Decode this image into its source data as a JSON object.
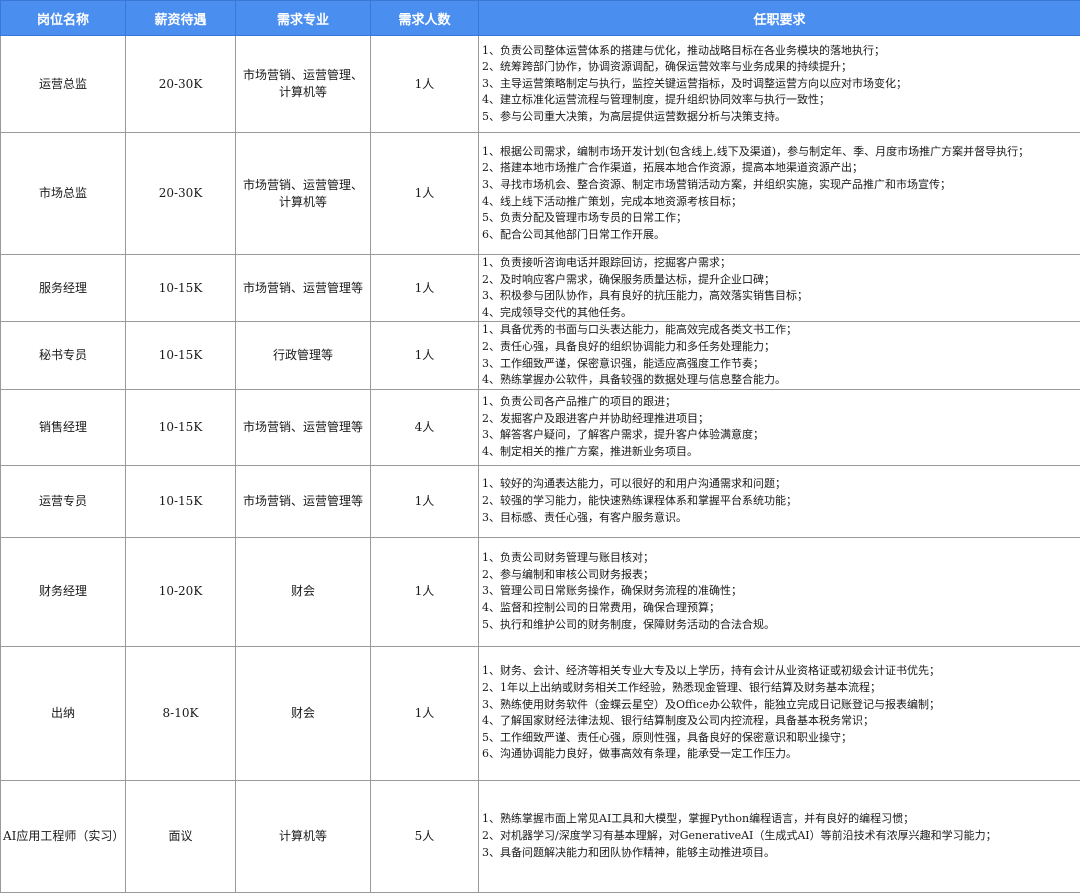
{
  "headers": [
    "岗位名称",
    "薪资待遇",
    "需求专业",
    "需求人数",
    "任职要求"
  ],
  "rows": [
    {
      "title": "运营总监",
      "salary": "20-30K",
      "major": "市场营销、运营管理、计算机等",
      "count": "1人",
      "requirements": [
        "1、负责公司整体运营体系的搭建与优化，推动战略目标在各业务模块的落地执行；",
        "2、统筹跨部门协作，协调资源调配，确保运营效率与业务成果的持续提升；",
        "3、主导运营策略制定与执行，监控关键运营指标，及时调整运营方向以应对市场变化；",
        "4、建立标准化运营流程与管理制度，提升组织协同效率与执行一致性；",
        "5、参与公司重大决策，为高层提供运营数据分析与决策支持。"
      ]
    },
    {
      "title": "市场总监",
      "salary": "20-30K",
      "major": "市场营销、运营管理、计算机等",
      "count": "1人",
      "requirements": [
        "1、根据公司需求，编制市场开发计划(包含线上,线下及渠道)，参与制定年、季、月度市场推广方案并督导执行；",
        "2、搭建本地市场推广合作渠道，拓展本地合作资源，提高本地渠道资源产出；",
        "3、寻找市场机会、整合资源、制定市场营销活动方案，并组织实施，实现产品推广和市场宣传；",
        "4、线上线下活动推广策划，完成本地资源考核目标；",
        "5、负责分配及管理市场专员的日常工作；",
        "6、配合公司其他部门日常工作开展。"
      ]
    },
    {
      "title": "服务经理",
      "salary": "10-15K",
      "major": "市场营销、运营管理等",
      "count": "1人",
      "requirements": [
        "1、负责接听咨询电话并跟踪回访，挖掘客户需求；",
        "2、及时响应客户需求，确保服务质量达标，提升企业口碑；",
        "3、积极参与团队协作，具有良好的抗压能力，高效落实销售目标；",
        "4、完成领导交代的其他任务。"
      ]
    },
    {
      "title": "秘书专员",
      "salary": "10-15K",
      "major": "行政管理等",
      "count": "1人",
      "requirements": [
        "1、具备优秀的书面与口头表达能力，能高效完成各类文书工作；",
        "2、责任心强，具备良好的组织协调能力和多任务处理能力；",
        "3、工作细致严谨，保密意识强，能适应高强度工作节奏；",
        "4、熟练掌握办公软件，具备较强的数据处理与信息整合能力。"
      ]
    },
    {
      "title": "销售经理",
      "salary": "10-15K",
      "major": "市场营销、运营管理等",
      "count": "4人",
      "requirements": [
        "1、负责公司各产品推广的项目的跟进；",
        "2、发掘客户及跟进客户并协助经理推进项目；",
        "3、解答客户疑问，了解客户需求，提升客户体验满意度；",
        "4、制定相关的推广方案，推进新业务项目。"
      ]
    },
    {
      "title": "运营专员",
      "salary": "10-15K",
      "major": "市场营销、运营管理等",
      "count": "1人",
      "requirements": [
        "1、较好的沟通表达能力，可以很好的和用户沟通需求和问题；",
        "2、较强的学习能力，能快速熟练课程体系和掌握平台系统功能；",
        "3、目标感、责任心强，有客户服务意识。"
      ]
    },
    {
      "title": "财务经理",
      "salary": "10-20K",
      "major": "财会",
      "count": "1人",
      "requirements": [
        "1、负责公司财务管理与账目核对；",
        "2、参与编制和审核公司财务报表；",
        "3、管理公司日常账务操作，确保财务流程的准确性；",
        "4、监督和控制公司的日常费用，确保合理预算；",
        "5、执行和维护公司的财务制度，保障财务活动的合法合规。"
      ]
    },
    {
      "title": "出纳",
      "salary": "8-10K",
      "major": "财会",
      "count": "1人",
      "requirements": [
        "1、财务、会计、经济等相关专业大专及以上学历，持有会计从业资格证或初级会计证书优先；",
        "2、1年以上出纳或财务相关工作经验，熟悉现金管理、银行结算及财务基本流程；",
        "3、熟练使用财务软件（金蝶云星空）及Office办公软件，能独立完成日记账登记与报表编制；",
        "4、了解国家财经法律法规、银行结算制度及公司内控流程，具备基本税务常识；",
        "5、工作细致严谨、责任心强，原则性强，具备良好的保密意识和职业操守；",
        "6、沟通协调能力良好，做事高效有条理，能承受一定工作压力。"
      ]
    },
    {
      "title": "AI应用工程师（实习）",
      "salary": "面议",
      "major": "计算机等",
      "count": "5人",
      "requirements": [
        "1、熟练掌握市面上常见AI工具和大模型，掌握Python编程语言，并有良好的编程习惯；",
        "2、对机器学习/深度学习有基本理解，对GenerativeAI（生成式AI）等前沿技术有浓厚兴趣和学习能力；",
        "3、具备问题解决能力和团队协作精神，能够主动推进项目。"
      ]
    }
  ],
  "colors": {
    "header_bg": "#4a8ef0",
    "header_text": "#ffffff",
    "border": "#9a9a9a"
  }
}
